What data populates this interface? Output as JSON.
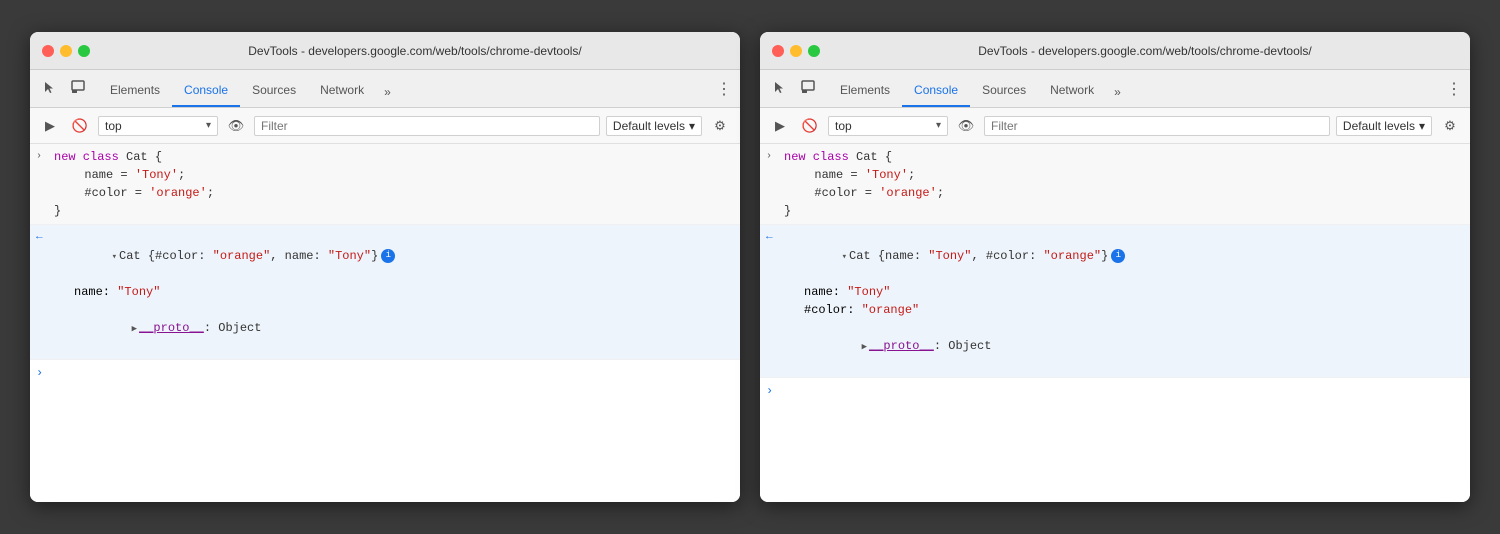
{
  "windows": [
    {
      "id": "window-left",
      "title": "DevTools - developers.google.com/web/tools/chrome-devtools/",
      "tabs": [
        {
          "id": "elements",
          "label": "Elements",
          "active": false
        },
        {
          "id": "console",
          "label": "Console",
          "active": true
        },
        {
          "id": "sources",
          "label": "Sources",
          "active": false
        },
        {
          "id": "network",
          "label": "Network",
          "active": false
        }
      ],
      "toolbar": {
        "context": "top",
        "filter_placeholder": "Filter",
        "levels": "Default levels"
      },
      "console": {
        "entries": [
          {
            "type": "input",
            "lines": [
              {
                "text": "new class Cat {",
                "parts": [
                  {
                    "t": "kw",
                    "v": "new class "
                  },
                  {
                    "t": "plain",
                    "v": "Cat {"
                  }
                ]
              },
              {
                "text": "  name = 'Tony';",
                "indent": true,
                "parts": [
                  {
                    "t": "plain",
                    "v": "  name = "
                  },
                  {
                    "t": "str",
                    "v": "'Tony'"
                  },
                  {
                    "t": "plain",
                    "v": ";"
                  }
                ]
              },
              {
                "text": "  #color = 'orange';",
                "indent": true,
                "parts": [
                  {
                    "t": "plain",
                    "v": "  #color = "
                  },
                  {
                    "t": "str",
                    "v": "'orange'"
                  },
                  {
                    "t": "plain",
                    "v": ";"
                  }
                ]
              },
              {
                "text": "}",
                "parts": [
                  {
                    "t": "plain",
                    "v": "}"
                  }
                ]
              }
            ]
          },
          {
            "type": "output",
            "collapsed": true,
            "summary": "▾Cat {#color: \"orange\", name: \"Tony\"}",
            "properties": [
              {
                "key": "name",
                "value": "\"Tony\""
              }
            ],
            "proto": "__proto__: Object"
          }
        ]
      }
    },
    {
      "id": "window-right",
      "title": "DevTools - developers.google.com/web/tools/chrome-devtools/",
      "tabs": [
        {
          "id": "elements",
          "label": "Elements",
          "active": false
        },
        {
          "id": "console",
          "label": "Console",
          "active": true
        },
        {
          "id": "sources",
          "label": "Sources",
          "active": false
        },
        {
          "id": "network",
          "label": "Network",
          "active": false
        }
      ],
      "toolbar": {
        "context": "top",
        "filter_placeholder": "Filter",
        "levels": "Default levels"
      },
      "console": {
        "entries": [
          {
            "type": "input",
            "lines": [
              {
                "text": "new class Cat {",
                "parts": [
                  {
                    "t": "kw",
                    "v": "new class "
                  },
                  {
                    "t": "plain",
                    "v": "Cat {"
                  }
                ]
              },
              {
                "text": "  name = 'Tony';",
                "parts": [
                  {
                    "t": "plain",
                    "v": "  name = "
                  },
                  {
                    "t": "str",
                    "v": "'Tony'"
                  },
                  {
                    "t": "plain",
                    "v": ";"
                  }
                ]
              },
              {
                "text": "  #color = 'orange';",
                "parts": [
                  {
                    "t": "plain",
                    "v": "  #color = "
                  },
                  {
                    "t": "str",
                    "v": "'orange'"
                  },
                  {
                    "t": "plain",
                    "v": ";"
                  }
                ]
              },
              {
                "text": "}",
                "parts": [
                  {
                    "t": "plain",
                    "v": "}"
                  }
                ]
              }
            ]
          },
          {
            "type": "output",
            "expanded": true,
            "summary": "▾Cat {name: \"Tony\", #color: \"orange\"}",
            "properties": [
              {
                "key": "name",
                "value": "\"Tony\""
              },
              {
                "key": "#color",
                "value": "\"orange\""
              }
            ],
            "proto": "__proto__: Object"
          }
        ]
      }
    }
  ],
  "labels": {
    "more_tabs": "»",
    "menu": "⋮",
    "default_levels": "Default levels",
    "filter": "Filter",
    "top": "top",
    "info": "i",
    "proto_text": "__proto__",
    "object": "Object"
  }
}
